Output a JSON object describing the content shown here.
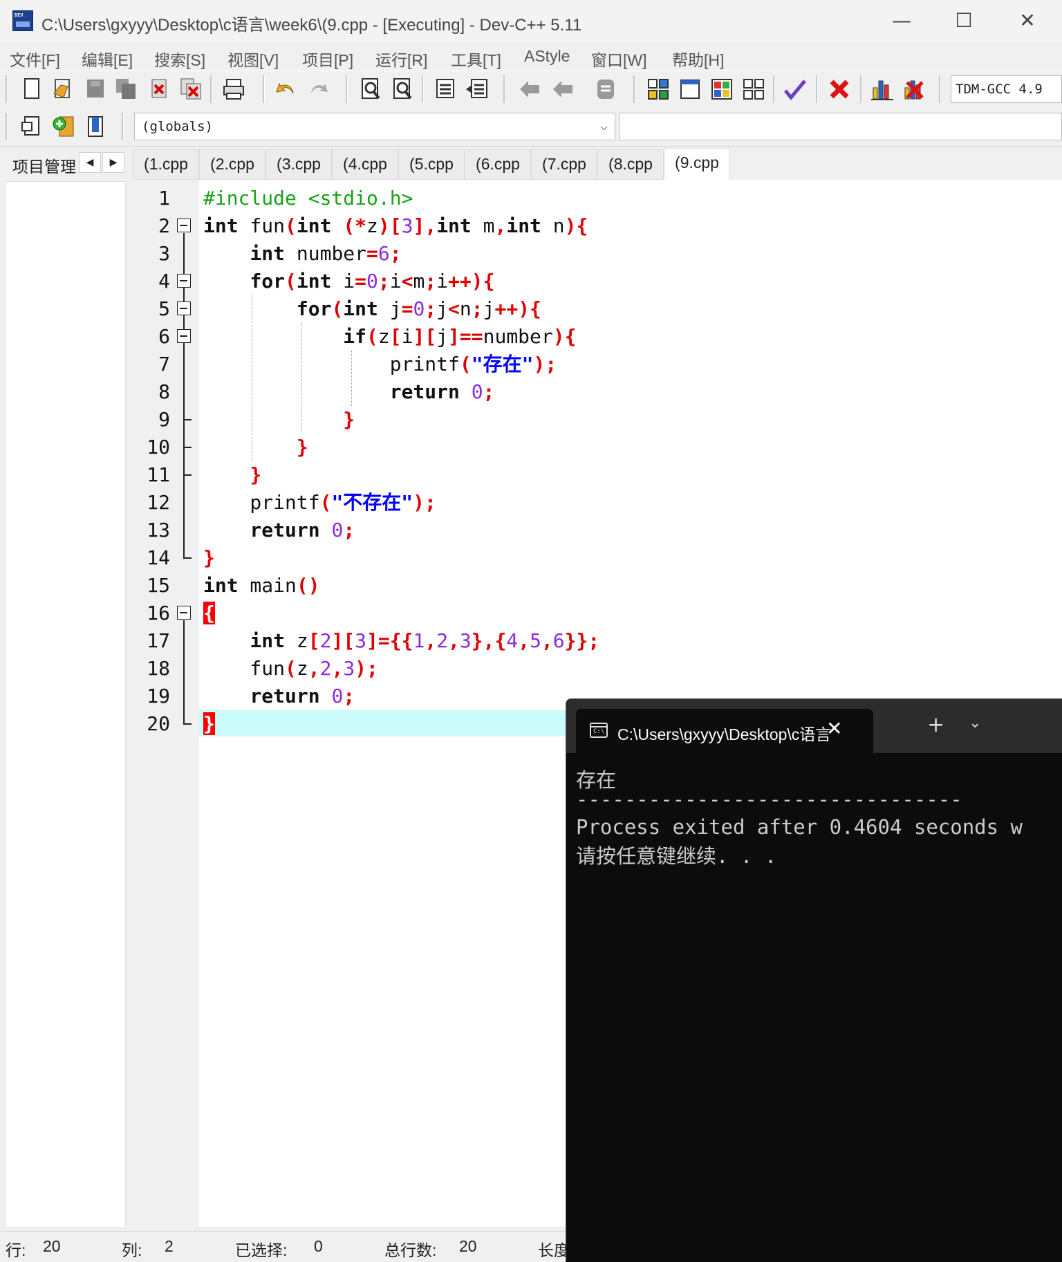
{
  "window": {
    "title": "C:\\Users\\gxyyy\\Desktop\\c语言\\week6\\(9.cpp - [Executing] - Dev-C++ 5.11",
    "controls": {
      "minimize": "—",
      "maximize": "☐",
      "close": "✕"
    }
  },
  "menu": [
    "文件[F]",
    "编辑[E]",
    "搜索[S]",
    "视图[V]",
    "项目[P]",
    "运行[R]",
    "工具[T]",
    "AStyle",
    "窗口[W]",
    "帮助[H]"
  ],
  "toolbar": {
    "compiler": "TDM-GCC 4.9",
    "icons": [
      "new-file-icon",
      "open-file-icon",
      "save-icon",
      "save-all-icon",
      "close-file-icon",
      "close-all-icon",
      "print-icon",
      "undo-icon",
      "redo-icon",
      "find-icon",
      "replace-icon",
      "indent-icon",
      "unindent-icon",
      "goto-back-icon",
      "goto-forward-icon",
      "toggle-comment-icon",
      "compile-icon",
      "run-icon",
      "compile-run-icon",
      "rebuild-icon",
      "syntax-check-icon",
      "stop-icon",
      "profile-icon",
      "delete-profile-icon"
    ]
  },
  "toolbar2": {
    "icons": [
      "new-project-icon",
      "add-to-project-icon",
      "class-browser-icon"
    ],
    "scope": "(globals)",
    "members": ""
  },
  "left_panel": {
    "tab_label": "项目管理",
    "prev": "◀",
    "next": "▶"
  },
  "file_tabs": [
    "(1.cpp",
    "(2.cpp",
    "(3.cpp",
    "(4.cpp",
    "(5.cpp",
    "(6.cpp",
    "(7.cpp",
    "(8.cpp",
    "(9.cpp"
  ],
  "active_tab": "(9.cpp",
  "code": {
    "line_numbers": [
      "1",
      "2",
      "3",
      "4",
      "5",
      "6",
      "7",
      "8",
      "9",
      "10",
      "11",
      "12",
      "13",
      "14",
      "15",
      "16",
      "17",
      "18",
      "19",
      "20"
    ],
    "lines": [
      "#include <stdio.h>",
      "int fun(int (*z)[3],int m,int n){",
      "    int number=6;",
      "    for(int i=0;i<m;i++){",
      "        for(int j=0;j<n;j++){",
      "            if(z[i][j]==number){",
      "                printf(\"存在\");",
      "                return 0;",
      "            }",
      "        }",
      "    }",
      "    printf(\"不存在\");",
      "    return 0;",
      "}",
      "int main()",
      "{",
      "    int z[2][3]={{1,2,3},{4,5,6}};",
      "    fun(z,2,3);",
      "    return 0;",
      "}"
    ],
    "highlighted_line": 20
  },
  "status": {
    "row_label": "行:",
    "row_value": "20",
    "col_label": "列:",
    "col_value": "2",
    "sel_label": "已选择:",
    "sel_value": "0",
    "total_label": "总行数:",
    "total_value": "20",
    "len_label": "长度"
  },
  "console": {
    "tab_title": "C:\\Users\\gxyyy\\Desktop\\c语言",
    "close": "✕",
    "new_tab": "+",
    "dropdown": "⌄",
    "output": [
      "存在",
      "--------------------------------",
      "Process exited after 0.4604 seconds w",
      "请按任意键继续. . ."
    ]
  }
}
